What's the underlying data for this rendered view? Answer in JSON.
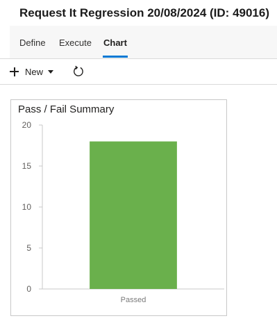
{
  "page": {
    "title": "Request It Regression 20/08/2024 (ID: 49016)"
  },
  "tabs": [
    {
      "label": "Define",
      "active": false
    },
    {
      "label": "Execute",
      "active": false
    },
    {
      "label": "Chart",
      "active": true
    }
  ],
  "toolbar": {
    "new_label": "New",
    "new_icon": "plus-icon",
    "dropdown_icon": "chevron-down-icon",
    "refresh_icon": "refresh-icon"
  },
  "chart_card": {
    "title": "Pass / Fail Summary"
  },
  "chart_data": {
    "type": "bar",
    "title": "Pass / Fail Summary",
    "categories": [
      "Passed"
    ],
    "values": [
      18
    ],
    "yticks": [
      "0",
      "5",
      "10",
      "15",
      "20"
    ],
    "ylim": [
      0,
      20
    ],
    "xlabel": "",
    "ylabel": "",
    "grid": false,
    "bar_color": "#6ab04c"
  },
  "colors": {
    "accent": "#0078d4",
    "bar": "#6ab04c"
  }
}
